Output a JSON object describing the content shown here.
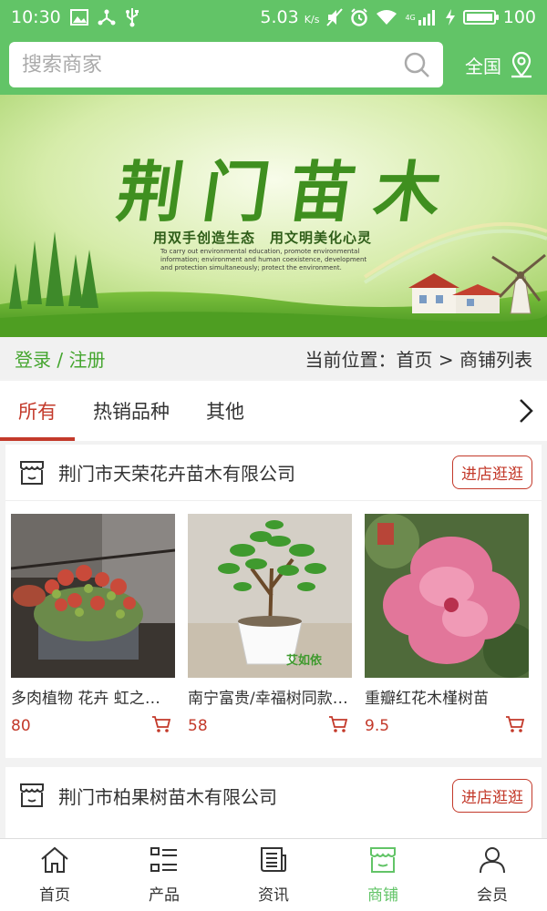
{
  "status_bar": {
    "time": "10:30",
    "speed": "5.03",
    "speed_unit": "K/s",
    "network": "4G",
    "battery": "100"
  },
  "search": {
    "placeholder": "搜索商家",
    "region_label": "全国"
  },
  "banner": {
    "title": "荆门苗木",
    "subtitle": "用双手创造生态　用文明美化心灵",
    "small_text": "To carry out environmental education, promote environmental information; environment and human coexistence, development and protection simultaneously; protect the environment."
  },
  "location_bar": {
    "login_label": "登录 / 注册",
    "breadcrumb": "当前位置：首页 > 商铺列表"
  },
  "tabs": [
    {
      "label": "所有"
    },
    {
      "label": "热销品种"
    },
    {
      "label": "其他"
    }
  ],
  "shops": [
    {
      "name": "荆门市天荣花卉苗木有限公司",
      "enter_label": "进店逛逛",
      "products": [
        {
          "name": "多肉植物 花卉 虹之玉锦",
          "price": "80"
        },
        {
          "name": "南宁富贵/幸福树同款盆栽",
          "price": "58"
        },
        {
          "name": "重瓣红花木槿树苗",
          "price": "9.5"
        }
      ]
    },
    {
      "name": "荆门市柏果树苗木有限公司",
      "enter_label": "进店逛逛"
    }
  ],
  "product_watermark": "艾如依",
  "bottom_nav": [
    {
      "label": "首页",
      "icon": "home-icon"
    },
    {
      "label": "产品",
      "icon": "list-icon"
    },
    {
      "label": "资讯",
      "icon": "news-icon"
    },
    {
      "label": "商铺",
      "icon": "store-icon"
    },
    {
      "label": "会员",
      "icon": "user-icon"
    }
  ],
  "colors": {
    "primary_green": "#62c467",
    "accent_red": "#c3392a",
    "link_green": "#44a52e"
  }
}
